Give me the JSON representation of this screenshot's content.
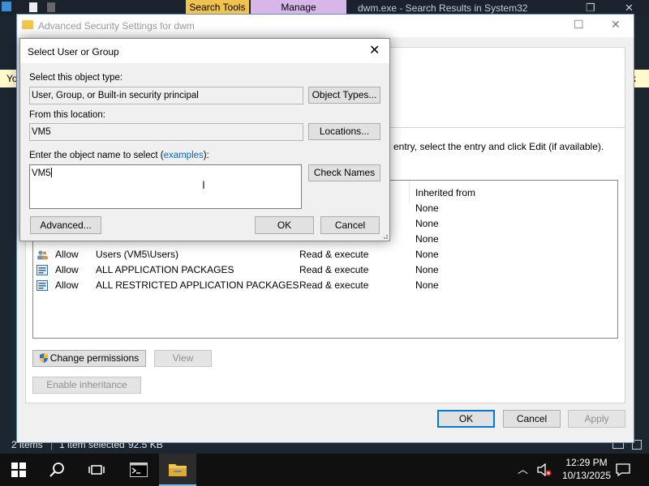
{
  "explorer": {
    "context_tabs": [
      "Search Tools",
      "Manage"
    ],
    "window_title": "dwm.exe - Search Results in System32",
    "notice_left": "Yo",
    "notice_right": "k",
    "status_items": "2 items",
    "status_selected": "1 item selected",
    "status_size": "92.5 KB"
  },
  "adv_window": {
    "title": "Advanced Security Settings for dwm",
    "info_text": "entry, select the entry and click Edit (if available).",
    "columns": {
      "inherited_from": "Inherited from"
    },
    "rows": [
      {
        "type": "",
        "principal": "",
        "access": "",
        "inherited": "None"
      },
      {
        "type": "",
        "principal": "",
        "access": "",
        "inherited": "None"
      },
      {
        "type": "",
        "principal": "",
        "access": "",
        "inherited": "None"
      },
      {
        "type": "Allow",
        "principal": "Users (VM5\\Users)",
        "access": "Read & execute",
        "inherited": "None"
      },
      {
        "type": "Allow",
        "principal": "ALL APPLICATION PACKAGES",
        "access": "Read & execute",
        "inherited": "None"
      },
      {
        "type": "Allow",
        "principal": "ALL RESTRICTED APPLICATION PACKAGES",
        "access": "Read & execute",
        "inherited": "None"
      }
    ],
    "change_permissions": "Change permissions",
    "view": "View",
    "enable_inheritance": "Enable inheritance",
    "ok": "OK",
    "cancel": "Cancel",
    "apply": "Apply"
  },
  "dialog": {
    "title": "Select User or Group",
    "object_type_label": "Select this object type:",
    "object_type_value": "User, Group, or Built-in security principal",
    "object_types_button": "Object Types...",
    "location_label": "From this location:",
    "location_value": "VM5",
    "locations_button": "Locations...",
    "name_label_pre": "Enter the object name to select (",
    "name_label_link": "examples",
    "name_label_post": "):",
    "name_value": "VM5",
    "check_names_button": "Check Names",
    "advanced_button": "Advanced...",
    "ok_button": "OK",
    "cancel_button": "Cancel"
  },
  "taskbar": {
    "time": "12:29 PM",
    "date": "10/13/2025"
  },
  "colors": {
    "accent": "#0078d7",
    "context_search": "#f0c34d",
    "context_manage": "#d7b6ea"
  }
}
